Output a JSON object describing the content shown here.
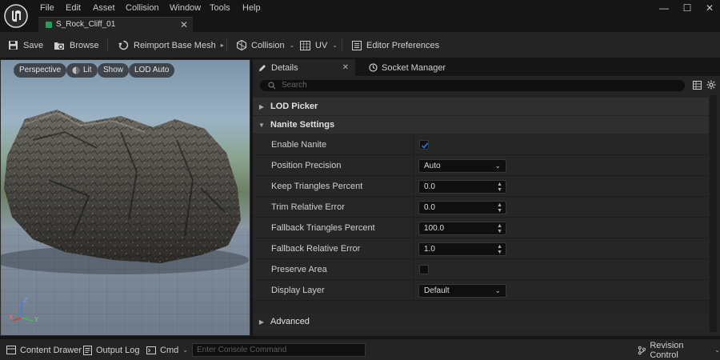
{
  "menu": {
    "items": [
      "File",
      "Edit",
      "Asset",
      "Collision",
      "Window",
      "Tools",
      "Help"
    ]
  },
  "window_controls": {
    "minimize": "—",
    "maximize": "☐",
    "close": "✕"
  },
  "document_tab": {
    "label": "S_Rock_Cliff_01",
    "close": "✕",
    "accent_color": "#1fa25a"
  },
  "toolbar": {
    "save": "Save",
    "browse": "Browse",
    "reimport": "Reimport Base Mesh",
    "collision": "Collision",
    "uv": "UV",
    "editor_preferences": "Editor Preferences"
  },
  "viewport": {
    "perspective": "Perspective",
    "lit": "Lit",
    "show": "Show",
    "lod": "LOD Auto",
    "axes": {
      "z": "Z",
      "x": "X",
      "y": "Y"
    }
  },
  "panel_tabs": {
    "details": "Details",
    "details_close": "✕",
    "socket_manager": "Socket Manager"
  },
  "details": {
    "search_placeholder": "Search",
    "sections": {
      "lod_picker": "LOD Picker",
      "nanite_settings": "Nanite Settings",
      "advanced": "Advanced"
    },
    "props": {
      "enable_nanite": {
        "label": "Enable Nanite",
        "checked": true
      },
      "position_precision": {
        "label": "Position Precision",
        "value": "Auto"
      },
      "keep_triangles_percent": {
        "label": "Keep Triangles Percent",
        "value": "0.0"
      },
      "trim_relative_error": {
        "label": "Trim Relative Error",
        "value": "0.0"
      },
      "fallback_triangles_percent": {
        "label": "Fallback Triangles Percent",
        "value": "100.0"
      },
      "fallback_relative_error": {
        "label": "Fallback Relative Error",
        "value": "1.0"
      },
      "preserve_area": {
        "label": "Preserve Area",
        "checked": false
      },
      "display_layer": {
        "label": "Display Layer",
        "value": "Default"
      }
    }
  },
  "statusbar": {
    "content_drawer": "Content Drawer",
    "output_log": "Output Log",
    "cmd": "Cmd",
    "console_placeholder": "Enter Console Command",
    "revision_control": "Revision Control"
  },
  "colors": {
    "checkbox_accent": "#2a6fd6",
    "background": "#242424"
  }
}
